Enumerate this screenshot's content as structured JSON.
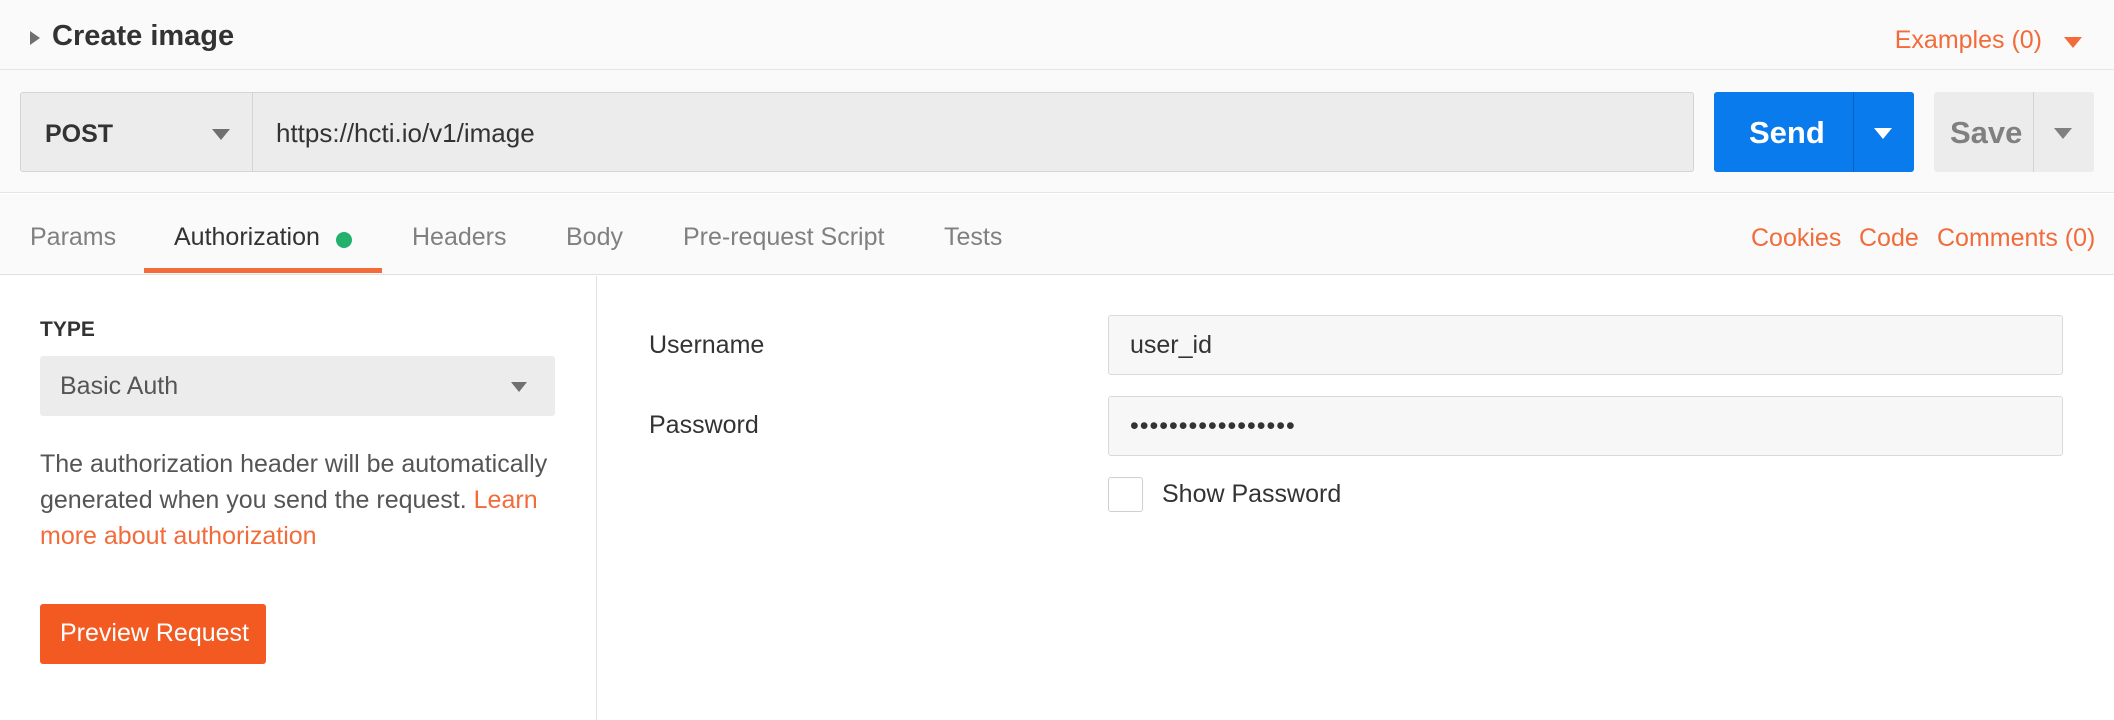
{
  "request": {
    "name": "Create image",
    "examples_label": "Examples (0)",
    "method": "POST",
    "url": "https://hcti.io/v1/image",
    "send_label": "Send",
    "save_label": "Save"
  },
  "tabs": [
    {
      "label": "Params",
      "active": false
    },
    {
      "label": "Authorization",
      "active": true
    },
    {
      "label": "Headers",
      "active": false
    },
    {
      "label": "Body",
      "active": false
    },
    {
      "label": "Pre-request Script",
      "active": false
    },
    {
      "label": "Tests",
      "active": false
    }
  ],
  "right_links": [
    "Cookies",
    "Code",
    "Comments (0)"
  ],
  "auth": {
    "type_heading": "TYPE",
    "type_value": "Basic Auth",
    "description": "The authorization header will be automatically generated when you send the request.",
    "learn_more": "Learn more about authorization",
    "preview_label": "Preview Request"
  },
  "form": {
    "username_label": "Username",
    "username_value": "user_id",
    "password_label": "Password",
    "password_value": "•••••••••••••••••",
    "show_password_label": "Show Password",
    "show_password_checked": false
  },
  "colors": {
    "accent": "#f26b3a",
    "send": "#097bed",
    "active_dot": "#23b06d",
    "preview_button": "#f25a22"
  }
}
